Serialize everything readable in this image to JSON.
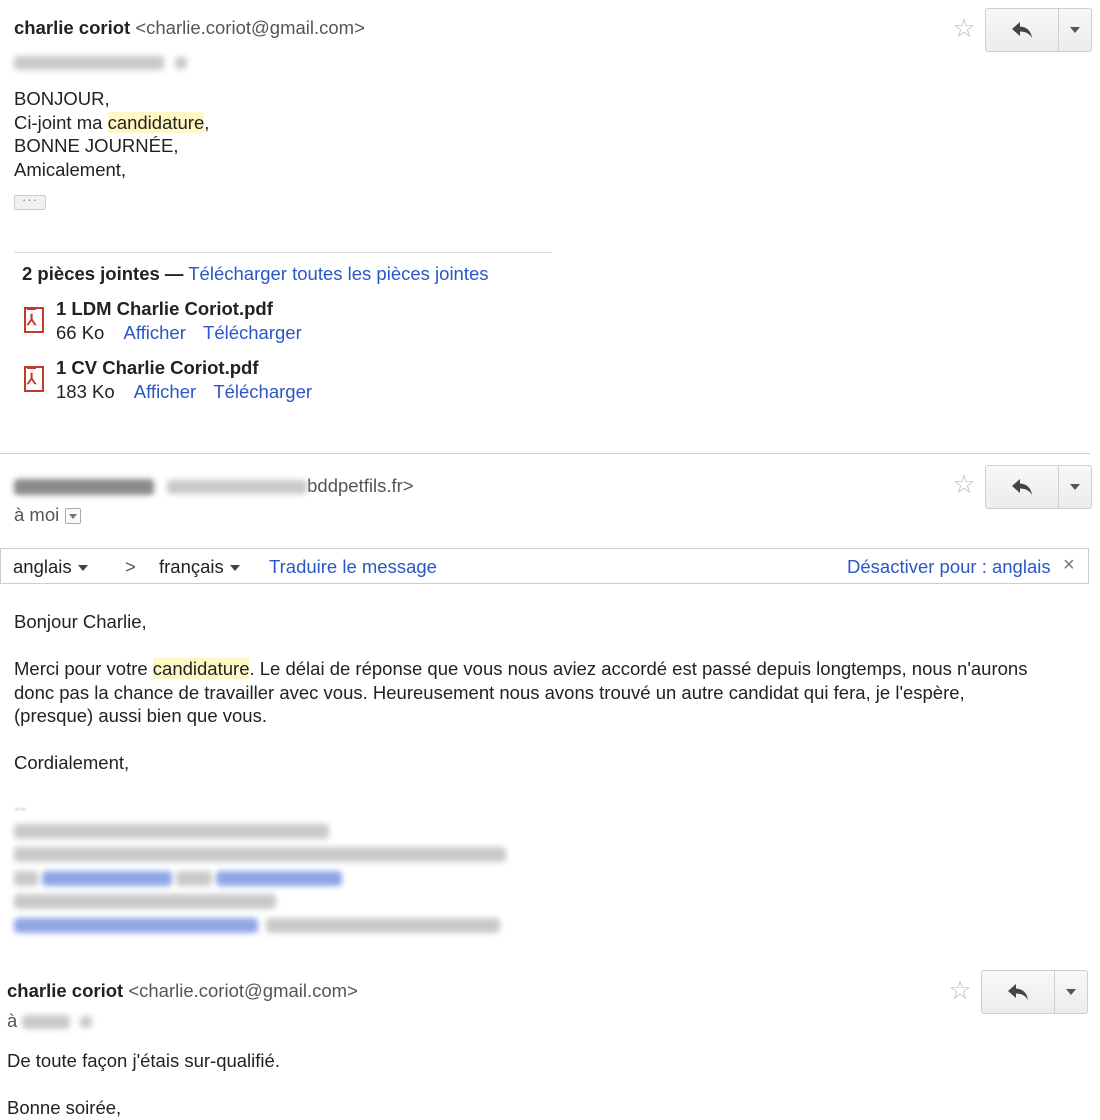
{
  "messages": [
    {
      "sender_name": "charlie coriot",
      "sender_email": "<charlie.coriot@gmail.com>",
      "body_lines": [
        "BONJOUR,",
        "Ci-joint ma ",
        "candidature",
        ",",
        "BONNE JOURNÉE,",
        "Amicalement,"
      ],
      "more_label": "···",
      "attachments_count_label": "2 pièces jointes —",
      "download_all_label": "Télécharger toutes les pièces jointes",
      "attachments": [
        {
          "name": "1 LDM Charlie Coriot.pdf",
          "size": "66 Ko",
          "view": "Afficher",
          "download": "Télécharger"
        },
        {
          "name": "1 CV Charlie Coriot.pdf",
          "size": "183 Ko",
          "view": "Afficher",
          "download": "Télécharger"
        }
      ]
    },
    {
      "sender_email_domain": "bddpetfils.fr>",
      "recipient_label": "à moi",
      "body_greeting": "Bonjour Charlie,",
      "body_p1_a": "Merci pour votre ",
      "body_p1_hl": "candidature",
      "body_p1_b": ". Le délai de réponse que vous nous aviez accordé est passé depuis longtemps, nous n'aurons",
      "body_p1_line2": "donc pas la chance de travailler avec vous. Heureusement nous avons trouvé un autre candidat qui fera, je l'espère,",
      "body_p1_line3": "(presque) aussi bien que vous.",
      "closing": "Cordialement,",
      "sig_dash": "--"
    },
    {
      "sender_name": "charlie coriot",
      "sender_email": "<charlie.coriot@gmail.com>",
      "recipient_prefix": "à",
      "body_line1": "De toute façon j'étais sur-qualifié.",
      "body_line2": "Bonne soirée,"
    }
  ],
  "translate_bar": {
    "source_lang": "anglais",
    "arrow": ">",
    "target_lang": "français",
    "translate_label": "Traduire le message",
    "disable_label": "Désactiver pour : anglais",
    "close_label": "×"
  },
  "icons": {
    "star": "☆",
    "reply": "reply-arrow",
    "pdf": "pdf-icon"
  }
}
